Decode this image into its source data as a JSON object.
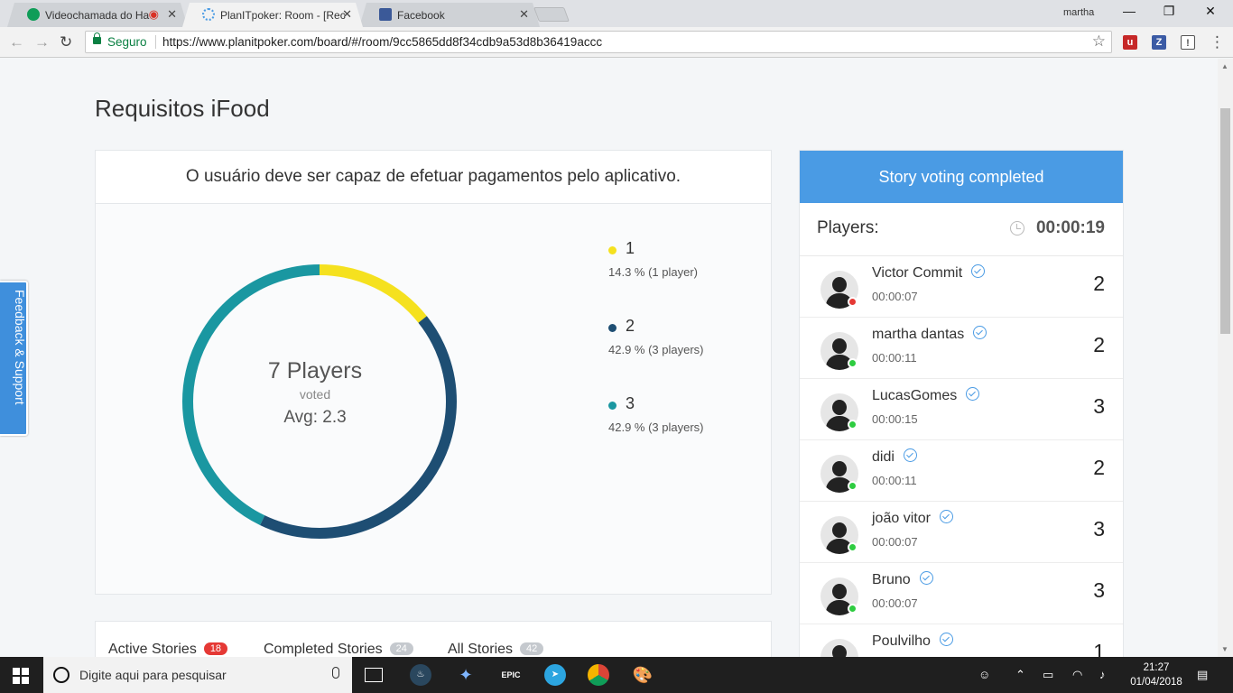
{
  "browser": {
    "tabs": [
      {
        "title": "Videochamada do Ha",
        "active": false
      },
      {
        "title": "PlanITpoker: Room - [Rec",
        "active": true
      },
      {
        "title": "Facebook",
        "active": false
      }
    ],
    "profile": "martha",
    "secure_label": "Seguro",
    "url": "https://www.planitpoker.com/board/#/room/9cc5865dd8f34cdb9a53d8b36419accc"
  },
  "room": {
    "title": "Requisitos iFood",
    "story": "O usuário deve ser capaz de efetuar pagamentos pelo aplicativo.",
    "summary": {
      "players": "7 Players",
      "voted": "voted",
      "avg": "Avg: 2.3"
    },
    "legend": [
      {
        "value": "1",
        "percent": "14.3 % (1 player)",
        "color": "#f5e11f"
      },
      {
        "value": "2",
        "percent": "42.9 % (3 players)",
        "color": "#1e4e73"
      },
      {
        "value": "3",
        "percent": "42.9 % (3 players)",
        "color": "#1a97a1"
      }
    ]
  },
  "chart_data": {
    "type": "pie",
    "style": "donut",
    "categories": [
      "1",
      "2",
      "3"
    ],
    "values": [
      14.3,
      42.9,
      42.9
    ],
    "counts": [
      1,
      3,
      3
    ],
    "colors": [
      "#f5e11f",
      "#1e4e73",
      "#1a97a1"
    ]
  },
  "story_tabs": [
    {
      "label": "Active Stories",
      "count": "18",
      "color": "#e53935"
    },
    {
      "label": "Completed Stories",
      "count": "24",
      "color": "#c5c9ce"
    },
    {
      "label": "All Stories",
      "count": "42",
      "color": "#c5c9ce"
    }
  ],
  "feedback_label": "Feedback & Support",
  "panel": {
    "banner": "Story voting completed",
    "players_label": "Players:",
    "timer": "00:00:19",
    "players": [
      {
        "name": "Victor Commit",
        "time": "00:00:07",
        "vote": "2",
        "status_color": "#e53935"
      },
      {
        "name": "martha dantas",
        "time": "00:00:11",
        "vote": "2",
        "status_color": "#2ecc40"
      },
      {
        "name": "LucasGomes",
        "time": "00:00:15",
        "vote": "3",
        "status_color": "#2ecc40"
      },
      {
        "name": "didi",
        "time": "00:00:11",
        "vote": "2",
        "status_color": "#2ecc40"
      },
      {
        "name": "joão vitor",
        "time": "00:00:07",
        "vote": "3",
        "status_color": "#2ecc40"
      },
      {
        "name": "Bruno",
        "time": "00:00:07",
        "vote": "3",
        "status_color": "#2ecc40"
      },
      {
        "name": "Poulvilho",
        "time": "",
        "vote": "1",
        "status_color": "#2ecc40"
      }
    ]
  },
  "taskbar": {
    "search_placeholder": "Digite aqui para pesquisar",
    "time": "21:27",
    "date": "01/04/2018"
  }
}
